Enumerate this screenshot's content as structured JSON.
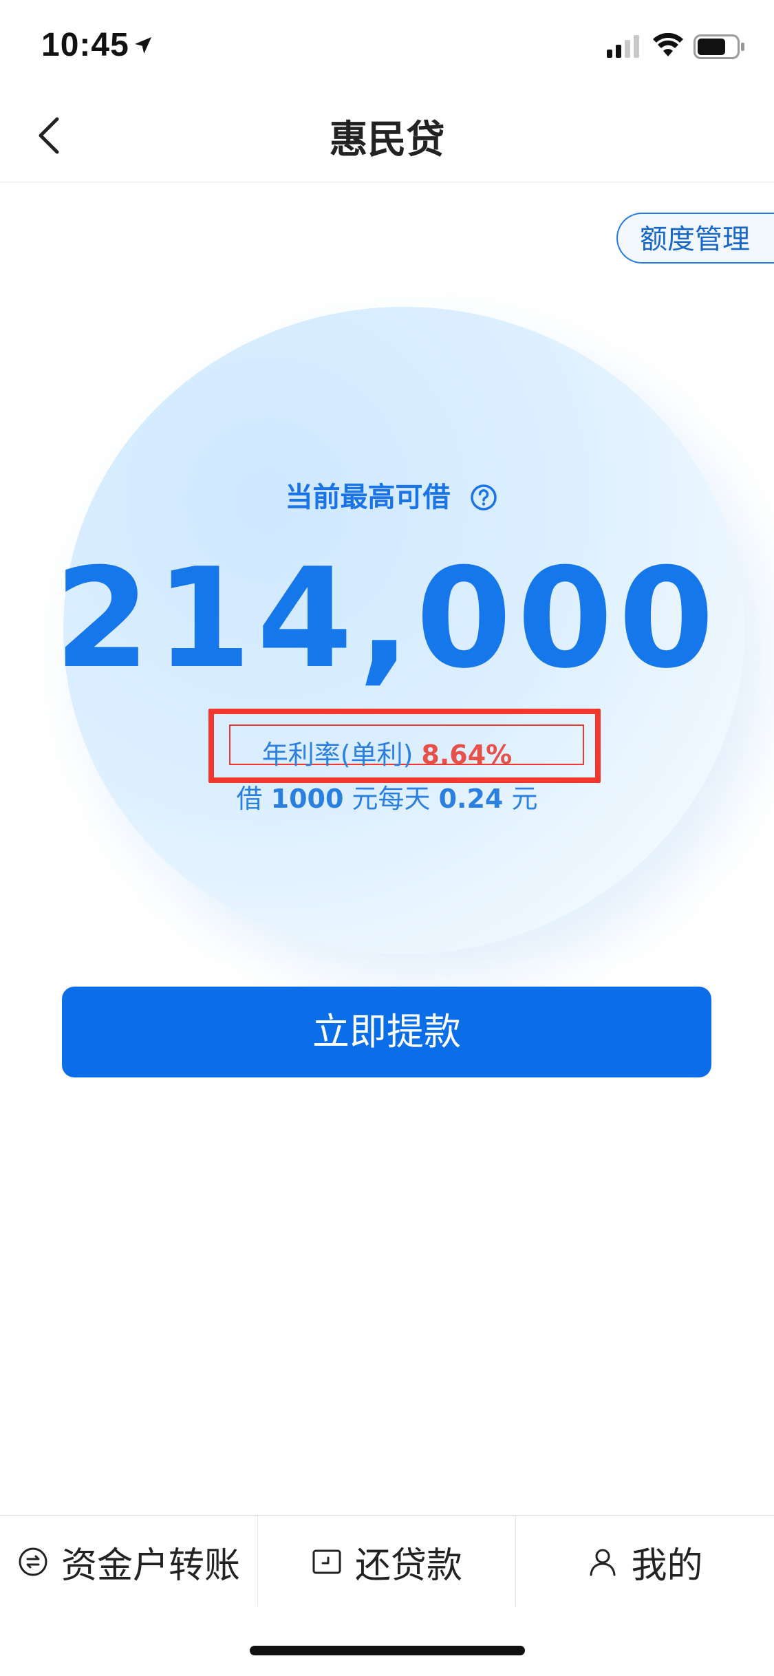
{
  "status_bar": {
    "time": "10:45"
  },
  "nav": {
    "title": "惠民贷"
  },
  "limit_manage": {
    "label": "额度管理"
  },
  "loan": {
    "label": "当前最高可借",
    "amount": "214,000",
    "rate_label": "年利率(单利)",
    "rate_value": "8.64%",
    "daily_prefix": "借",
    "daily_amount": "1000",
    "daily_mid": "元每天",
    "daily_value": "0.24",
    "daily_suffix": "元"
  },
  "withdraw": {
    "label": "立即提款"
  },
  "tabs": [
    {
      "label": "资金户转账",
      "icon": "transfer-icon"
    },
    {
      "label": "还贷款",
      "icon": "repay-icon"
    },
    {
      "label": "我的",
      "icon": "user-icon"
    }
  ],
  "colors": {
    "primary": "#0b6ee9",
    "accent_text": "#1677ea",
    "rate_red": "#e8504a",
    "highlight_box": "#f2382c"
  }
}
